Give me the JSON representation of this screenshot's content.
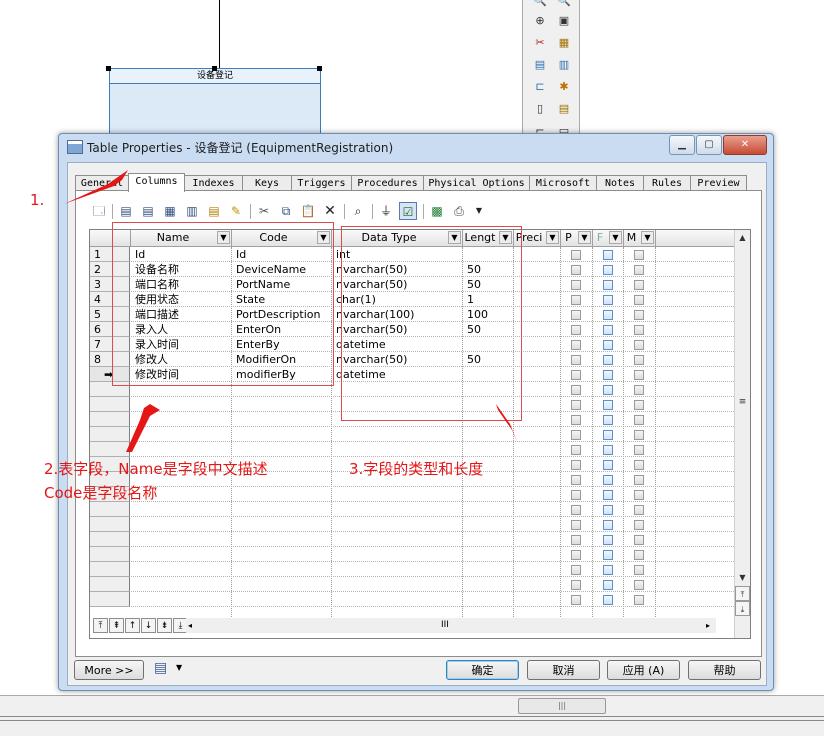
{
  "background": {
    "entity_title": "设备登记"
  },
  "dialog": {
    "title": "Table Properties - 设备登记 (EquipmentRegistration)",
    "tabs": [
      {
        "label": "General"
      },
      {
        "label": "Columns"
      },
      {
        "label": "Indexes"
      },
      {
        "label": "Keys"
      },
      {
        "label": "Triggers"
      },
      {
        "label": "Procedures"
      },
      {
        "label": "Physical Options"
      },
      {
        "label": "Microsoft"
      },
      {
        "label": "Notes"
      },
      {
        "label": "Rules"
      },
      {
        "label": "Preview"
      }
    ],
    "active_tab": "Columns",
    "toolbar_icons": [
      "properties-icon",
      "add-row-icon",
      "insert-row-icon",
      "add-columns-icon",
      "copy-rows-icon",
      "paste-rows-icon",
      "wand-icon",
      "cut-icon",
      "copy-icon",
      "paste-icon",
      "delete-icon",
      "find-icon",
      "filter-icon",
      "customize-columns-icon",
      "excel-icon",
      "print-icon",
      "dropdown-arrow-icon"
    ],
    "grid": {
      "headers": [
        "Name",
        "Code",
        "Data Type",
        "Lengt",
        "Preci",
        "P",
        "F",
        "M"
      ],
      "rows": [
        {
          "num": "1",
          "name": "Id",
          "code": "Id",
          "type": "int",
          "length": ""
        },
        {
          "num": "2",
          "name": "设备名称",
          "code": "DeviceName",
          "type": "nvarchar(50)",
          "length": "50"
        },
        {
          "num": "3",
          "name": "端口名称",
          "code": "PortName",
          "type": "nvarchar(50)",
          "length": "50"
        },
        {
          "num": "4",
          "name": "使用状态",
          "code": "State",
          "type": "char(1)",
          "length": "1"
        },
        {
          "num": "5",
          "name": "端口描述",
          "code": "PortDescription",
          "type": "nvarchar(100)",
          "length": "100"
        },
        {
          "num": "6",
          "name": "录入人",
          "code": "EnterOn",
          "type": "nvarchar(50)",
          "length": "50"
        },
        {
          "num": "7",
          "name": "录入时间",
          "code": "EnterBy",
          "type": "datetime",
          "length": ""
        },
        {
          "num": "8",
          "name": "修改人",
          "code": "ModifierOn",
          "type": "nvarchar(50)",
          "length": "50"
        },
        {
          "num": "➡",
          "name": "修改时间",
          "code": "modifierBy",
          "type": "datetime",
          "length": ""
        }
      ],
      "hscroll_label": "III"
    },
    "buttons": {
      "more": "More >>",
      "ok": "确定",
      "cancel": "取消",
      "apply": "应用 (A)",
      "help": "帮助"
    }
  },
  "annotations": {
    "a1": "1.",
    "a2_line1": "2.表字段，Name是字段中文描述",
    "a2_line2": "Code是字段名称",
    "a3": "3.字段的类型和长度",
    "color": "#e51616"
  }
}
